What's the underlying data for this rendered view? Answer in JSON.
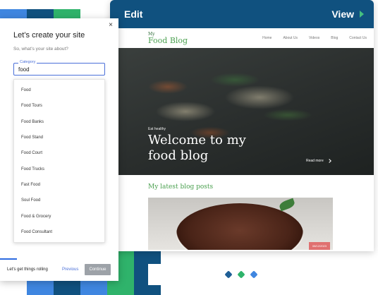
{
  "colors": {
    "editor_bar": "#10517f",
    "accent_green": "#44c080",
    "accent_blue": "#2d6be0",
    "link_blue": "#4a6fd8",
    "dot_blue_dark": "#1f5f96",
    "dot_green": "#2fb36b",
    "dot_blue_light": "#3f86e0"
  },
  "editor": {
    "edit_label": "Edit",
    "view_label": "View",
    "play_icon": "play-icon"
  },
  "site": {
    "logo_small": "My",
    "logo_name": "Food Blog",
    "nav": [
      "Home",
      "About Us",
      "Videos",
      "Blog",
      "Contact Us"
    ],
    "hero": {
      "eyebrow": "Eat healthy",
      "title": "Welcome to my food blog",
      "read_more": "Read more"
    },
    "section_title": "My latest blog posts",
    "post_date": "08/12/2023"
  },
  "panel": {
    "title": "Let’s create your site",
    "subtitle": "So, what’s your site about?",
    "category_label": "Category",
    "category_value": "food",
    "options": [
      "Food",
      "Food Tours",
      "Food Banks",
      "Food Stand",
      "Food Court",
      "Food Trucks",
      "Fast Food",
      "Soul Food",
      "Food & Grocery",
      "Food Consultant"
    ],
    "footer_message": "Let's get things rolling",
    "previous_label": "Previous",
    "continue_label": "Continue",
    "progress": 0.14
  }
}
